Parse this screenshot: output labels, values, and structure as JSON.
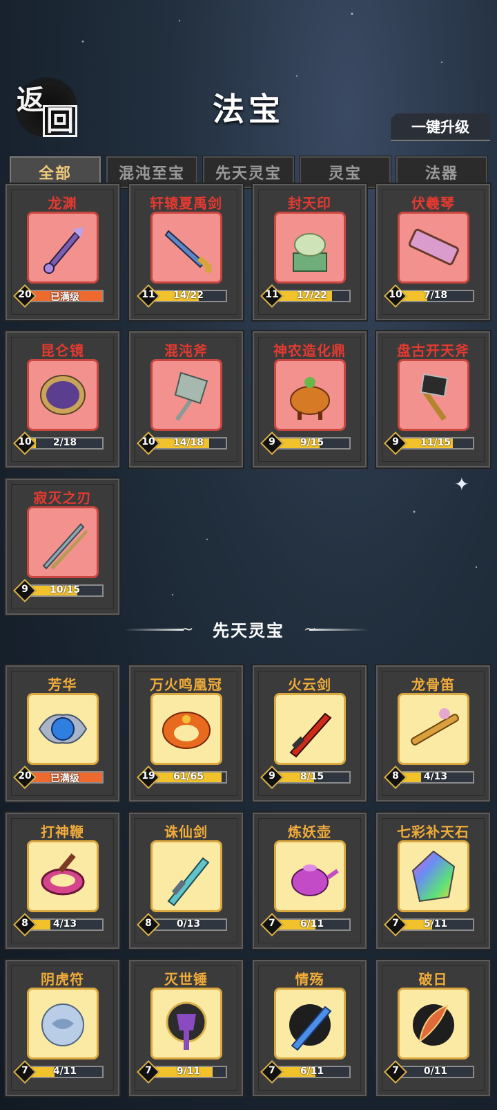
{
  "header": {
    "title": "法宝",
    "back_chars": [
      "返",
      "回"
    ],
    "upgrade_label": "一键升级"
  },
  "tabs": [
    {
      "label": "全部",
      "active": true
    },
    {
      "label": "混沌至宝",
      "active": false
    },
    {
      "label": "先天灵宝",
      "active": false
    },
    {
      "label": "灵宝",
      "active": false
    },
    {
      "label": "法器",
      "active": false
    }
  ],
  "section1": {
    "items": [
      {
        "name": "龙渊",
        "level": "20",
        "progress": "已满级",
        "ratio": 1.0,
        "max": true,
        "icon": "purple-sword-icon"
      },
      {
        "name": "轩辕夏禹剑",
        "level": "11",
        "progress": "14/22",
        "ratio": 0.64,
        "max": false,
        "icon": "golden-sword-icon"
      },
      {
        "name": "封天印",
        "level": "11",
        "progress": "17/22",
        "ratio": 0.77,
        "max": false,
        "icon": "jade-seal-icon"
      },
      {
        "name": "伏羲琴",
        "level": "10",
        "progress": "7/18",
        "ratio": 0.39,
        "max": false,
        "icon": "zither-icon"
      },
      {
        "name": "昆仑镜",
        "level": "10",
        "progress": "2/18",
        "ratio": 0.11,
        "max": false,
        "icon": "mirror-icon"
      },
      {
        "name": "混沌斧",
        "level": "10",
        "progress": "14/18",
        "ratio": 0.78,
        "max": false,
        "icon": "stone-axe-icon"
      },
      {
        "name": "神农造化鼎",
        "level": "9",
        "progress": "9/15",
        "ratio": 0.6,
        "max": false,
        "icon": "cauldron-icon"
      },
      {
        "name": "盘古开天斧",
        "level": "9",
        "progress": "11/15",
        "ratio": 0.73,
        "max": false,
        "icon": "battle-axe-icon"
      },
      {
        "name": "寂灭之刃",
        "level": "9",
        "progress": "10/15",
        "ratio": 0.67,
        "max": false,
        "icon": "twin-blade-icon"
      }
    ]
  },
  "section2": {
    "title": "先天灵宝",
    "items": [
      {
        "name": "芳华",
        "level": "20",
        "progress": "已满级",
        "ratio": 1.0,
        "max": true,
        "icon": "blue-orb-icon"
      },
      {
        "name": "万火鸣凰冠",
        "level": "19",
        "progress": "61/65",
        "ratio": 0.94,
        "max": false,
        "icon": "phoenix-crown-icon"
      },
      {
        "name": "火云剑",
        "level": "9",
        "progress": "8/15",
        "ratio": 0.53,
        "max": false,
        "icon": "fire-sword-icon"
      },
      {
        "name": "龙骨笛",
        "level": "8",
        "progress": "4/13",
        "ratio": 0.31,
        "max": false,
        "icon": "flute-icon"
      },
      {
        "name": "打神鞭",
        "level": "8",
        "progress": "4/13",
        "ratio": 0.31,
        "max": false,
        "icon": "whip-icon"
      },
      {
        "name": "诛仙剑",
        "level": "8",
        "progress": "0/13",
        "ratio": 0.0,
        "max": false,
        "icon": "cyan-sword-icon"
      },
      {
        "name": "炼妖壶",
        "level": "7",
        "progress": "6/11",
        "ratio": 0.55,
        "max": false,
        "icon": "teapot-icon"
      },
      {
        "name": "七彩补天石",
        "level": "7",
        "progress": "5/11",
        "ratio": 0.45,
        "max": false,
        "icon": "rainbow-crystal-icon"
      },
      {
        "name": "阴虎符",
        "level": "7",
        "progress": "4/11",
        "ratio": 0.36,
        "max": false,
        "icon": "tiger-talisman-icon"
      },
      {
        "name": "灭世锤",
        "level": "7",
        "progress": "9/11",
        "ratio": 0.82,
        "max": false,
        "icon": "hammer-icon"
      },
      {
        "name": "情殇",
        "level": "7",
        "progress": "6/11",
        "ratio": 0.55,
        "max": false,
        "icon": "ice-sword-icon"
      },
      {
        "name": "破日",
        "level": "7",
        "progress": "0/11",
        "ratio": 0.0,
        "max": false,
        "icon": "sun-blade-icon"
      }
    ]
  }
}
